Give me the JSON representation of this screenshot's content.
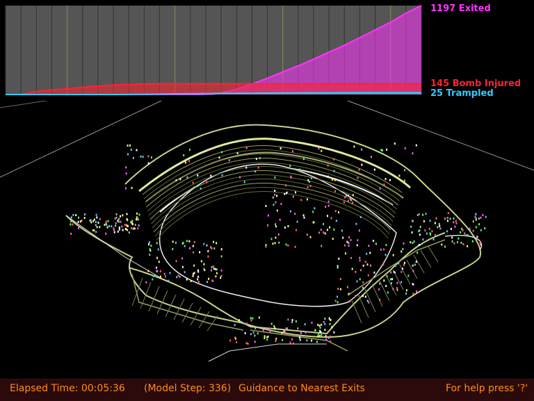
{
  "chart": {
    "exited_label": "1197  Exited",
    "bomb_label": "145  Bomb Injured",
    "trampled_label": "25  Trampled"
  },
  "chart_data": {
    "type": "area",
    "title": "",
    "xlabel": "",
    "ylabel": "",
    "grid": true,
    "legend_placement": "right",
    "series": [
      {
        "name": "Exited",
        "final_value": 1197,
        "color": "#ff33ff",
        "values": [
          0,
          0,
          0,
          0,
          0,
          0,
          0,
          0,
          0,
          0,
          0,
          0,
          0,
          0,
          5,
          40,
          100,
          170,
          250,
          330,
          410,
          500,
          590,
          680,
          780,
          880,
          980,
          1100,
          1197
        ]
      },
      {
        "name": "Bomb Injured",
        "final_value": 145,
        "color": "#ff2233",
        "values": [
          0,
          0,
          40,
          60,
          75,
          95,
          110,
          125,
          135,
          140,
          145,
          145,
          145,
          145,
          145,
          145,
          145,
          145,
          145,
          145,
          145,
          145,
          145,
          145,
          145,
          145,
          145,
          145,
          145
        ]
      },
      {
        "name": "Trampled",
        "final_value": 25,
        "color": "#33ccff",
        "values": [
          0,
          0,
          0,
          0,
          0,
          0,
          0,
          0,
          0,
          2,
          5,
          8,
          10,
          12,
          14,
          16,
          18,
          19,
          20,
          21,
          22,
          23,
          23,
          24,
          24,
          24,
          25,
          25,
          25
        ]
      }
    ]
  },
  "colors": {
    "exited": "#ff33ff",
    "bomb": "#ff2233",
    "trampled": "#33ccff",
    "status_text": "#ff8c1a",
    "status_bg": "#2a0a0a"
  },
  "status": {
    "elapsed": "Elapsed Time:  00:05:36",
    "model_step": "(Model Step: 336)",
    "guidance": "Guidance to Nearest Exits",
    "help": "For help press '?'"
  }
}
